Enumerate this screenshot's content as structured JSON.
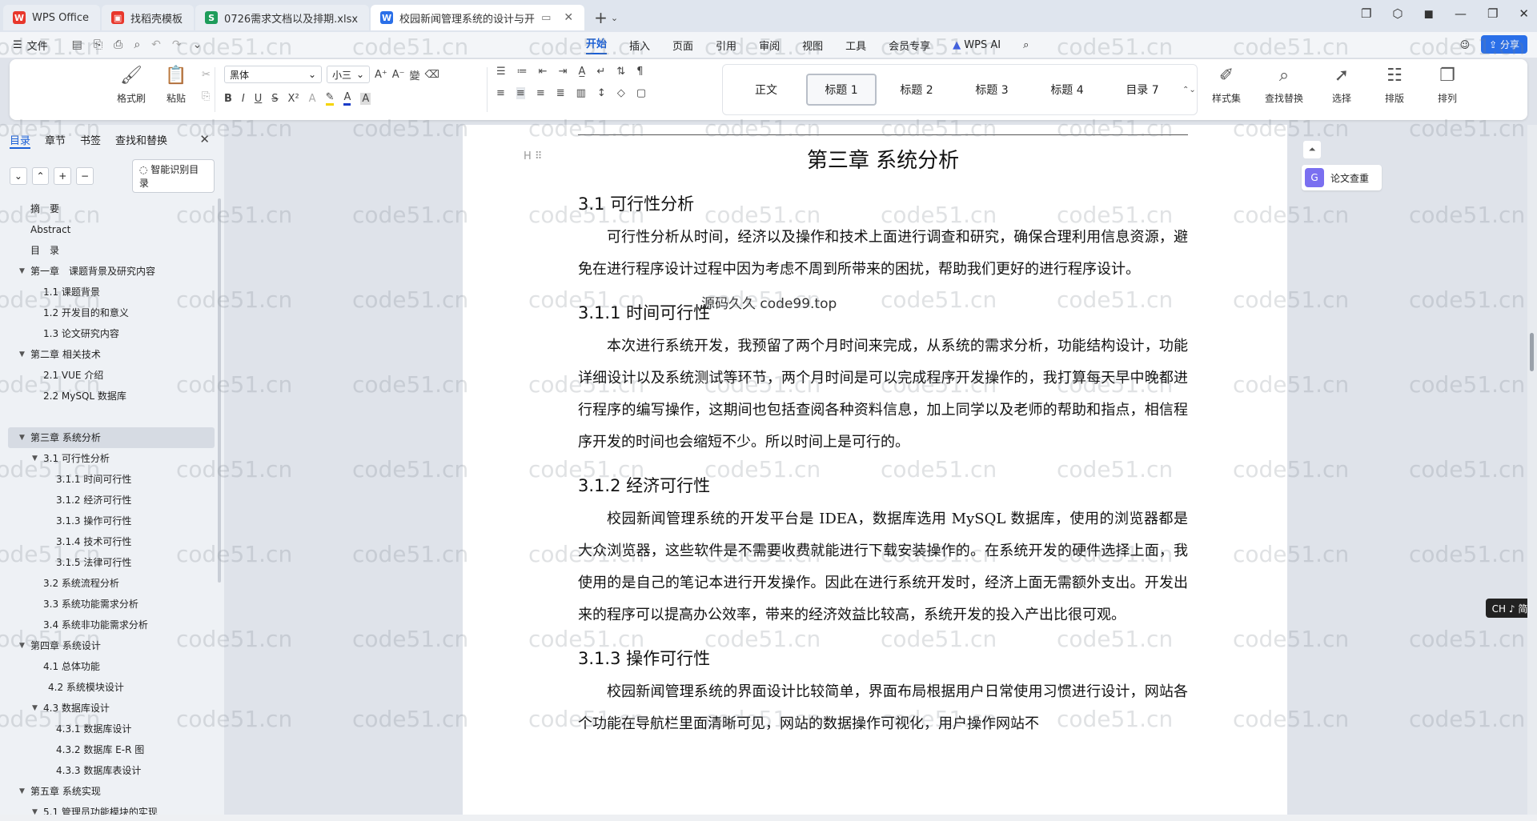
{
  "tabs": [
    {
      "label": "WPS Office",
      "logo": "W",
      "logo_color": "#e8372c"
    },
    {
      "label": "找稻壳模板",
      "logo": "▣",
      "logo_color": "#e8372c"
    },
    {
      "label": "0726需求文档以及排期.xlsx",
      "logo": "S",
      "logo_color": "#1e9c5a"
    },
    {
      "label": "校园新闻管理系统的设计与开",
      "logo": "W",
      "logo_color": "#2a6fe8",
      "active": true
    }
  ],
  "menu": {
    "file": "文件",
    "ribbon_tabs": [
      "开始",
      "插入",
      "页面",
      "引用",
      "审阅",
      "视图",
      "工具",
      "会员专享"
    ],
    "wps_ai": "WPS AI",
    "share": "分享"
  },
  "toolbar": {
    "format_painter": "格式刷",
    "paste": "粘贴",
    "font_name": "黑体",
    "font_size": "小三",
    "styles": [
      "正文",
      "标题 1",
      "标题 2",
      "标题 3",
      "标题 4",
      "目录 7"
    ],
    "style_set": "样式集",
    "find_replace": "查找替换",
    "select": "选择",
    "layout": "排版",
    "arrange": "排列"
  },
  "left_panel": {
    "tabs": [
      "目录",
      "章节",
      "书签",
      "查找和替换"
    ],
    "smart_toc": "智能识别目录",
    "toc": [
      {
        "label": "摘　要",
        "level": 1,
        "arrow": false
      },
      {
        "label": "Abstract",
        "level": 1,
        "arrow": false
      },
      {
        "label": "目　录",
        "level": 1,
        "arrow": false
      },
      {
        "label": "第一章　课题背景及研究内容",
        "level": 0,
        "arrow": true
      },
      {
        "label": "1.1 课题背景",
        "level": 2,
        "arrow": false
      },
      {
        "label": "1.2 开发目的和意义",
        "level": 2,
        "arrow": false
      },
      {
        "label": "1.3 论文研究内容",
        "level": 2,
        "arrow": false
      },
      {
        "label": "第二章 相关技术",
        "level": 0,
        "arrow": true
      },
      {
        "label": "2.1 VUE 介绍",
        "level": 2,
        "arrow": false
      },
      {
        "label": "2.2 MySQL 数据库",
        "level": 2,
        "arrow": false
      },
      {
        "label": "",
        "level": 1,
        "arrow": false
      },
      {
        "label": "第三章 系统分析",
        "level": 0,
        "arrow": true,
        "highlight": true
      },
      {
        "label": "3.1 可行性分析",
        "level": 1.5,
        "arrow": true
      },
      {
        "label": "3.1.1 时间可行性",
        "level": 3,
        "arrow": false
      },
      {
        "label": "3.1.2 经济可行性",
        "level": 3,
        "arrow": false
      },
      {
        "label": "3.1.3 操作可行性",
        "level": 3,
        "arrow": false
      },
      {
        "label": "3.1.4 技术可行性",
        "level": 3,
        "arrow": false
      },
      {
        "label": "3.1.5 法律可行性",
        "level": 3,
        "arrow": false
      },
      {
        "label": "3.2 系统流程分析",
        "level": 2,
        "arrow": false
      },
      {
        "label": "3.3 系统功能需求分析",
        "level": 2,
        "arrow": false
      },
      {
        "label": "3.4 系统非功能需求分析",
        "level": 2,
        "arrow": false
      },
      {
        "label": "第四章 系统设计",
        "level": 0,
        "arrow": true
      },
      {
        "label": "4.1 总体功能",
        "level": 2,
        "arrow": false
      },
      {
        "label": "4.2 系统模块设计",
        "level": 2.5,
        "arrow": false
      },
      {
        "label": "4.3 数据库设计",
        "level": 1.5,
        "arrow": true
      },
      {
        "label": "4.3.1 数据库设计",
        "level": 3,
        "arrow": false
      },
      {
        "label": "4.3.2 数据库 E-R 图",
        "level": 3,
        "arrow": false
      },
      {
        "label": "4.3.3 数据库表设计",
        "level": 3,
        "arrow": false
      },
      {
        "label": "第五章 系统实现",
        "level": 0,
        "arrow": true
      },
      {
        "label": "5.1 管理员功能模块的实现",
        "level": 1.5,
        "arrow": true
      }
    ]
  },
  "document": {
    "chapter": "第三章  系统分析",
    "s31": "3.1 可行性分析",
    "p31": "可行性分析从时间，经济以及操作和技术上面进行调查和研究，确保合理利用信息资源，避免在进行程序设计过程中因为考虑不周到所带来的困扰，帮助我们更好的进行程序设计。",
    "s311": "3.1.1 时间可行性",
    "p311": "本次进行系统开发，我预留了两个月时间来完成，从系统的需求分析，功能结构设计，功能详细设计以及系统测试等环节，两个月时间是可以完成程序开发操作的，我打算每天早中晚都进行程序的编写操作，这期间也包括查阅各种资料信息，加上同学以及老师的帮助和指点，相信程序开发的时间也会缩短不少。所以时间上是可行的。",
    "s312": "3.1.2  经济可行性",
    "p312": "校园新闻管理系统的开发平台是 IDEA，数据库选用 MySQL 数据库，使用的浏览器都是大众浏览器，这些软件是不需要收费就能进行下载安装操作的。在系统开发的硬件选择上面，我使用的是自己的笔记本进行开发操作。因此在进行系统开发时，经济上面无需额外支出。开发出来的程序可以提高办公效率，带来的经济效益比较高，系统开发的投入产出比很可观。",
    "s313": "3.1.3  操作可行性",
    "p313": "校园新闻管理系统的界面设计比较简单，界面布局根据用户日常使用习惯进行设计，网站各个功能在导航栏里面清晰可见，网站的数据操作可视化，用户操作网站不",
    "overlay_text": "源码久久 code99.top",
    "heading_marker": "H"
  },
  "right": {
    "plagiarism_check": "论文查重",
    "ime": "CH ♪ 简"
  },
  "watermark": "code51.cn"
}
